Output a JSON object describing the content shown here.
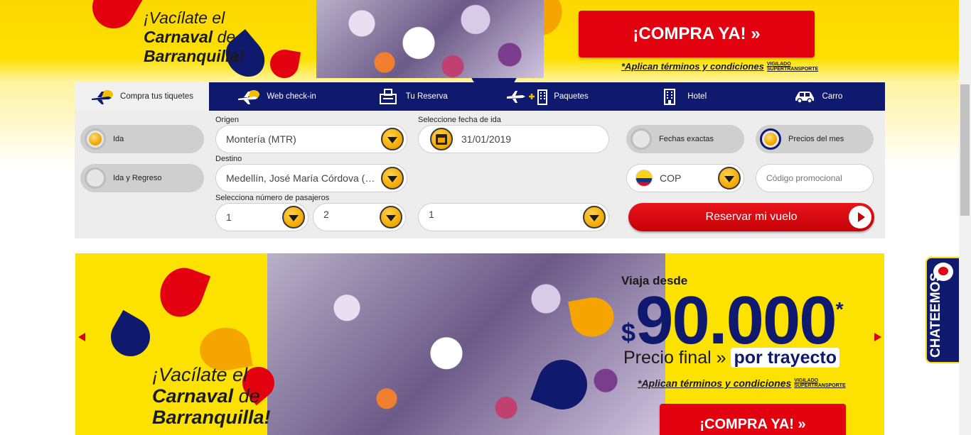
{
  "promo_top": {
    "title_line1": "¡Vacílate el",
    "title_line2_bold": "Carnaval",
    "title_line2_rest": "de",
    "title_line3": "Barranquilla!",
    "buy_label": "¡COMPRA YA!  »",
    "terms": "*Aplican términos y condiciones",
    "vigilado": "VIGILADO SUPERTRANSPORTE"
  },
  "tabs": [
    {
      "label": "Compra tus tiquetes",
      "icon": "plane-cloud-icon",
      "active": true
    },
    {
      "label": "Web check-in",
      "icon": "plane-cloud-icon"
    },
    {
      "label": "Tu Reserva",
      "icon": "ticket-icon"
    },
    {
      "label": "Paquetes",
      "icon": "plane-hotel-icon"
    },
    {
      "label": "Hotel",
      "icon": "building-icon"
    },
    {
      "label": "Carro",
      "icon": "car-icon"
    }
  ],
  "trip_type": {
    "one_way": "Ida",
    "round_trip": "Ida y Regreso",
    "selected": "Ida"
  },
  "origin": {
    "label": "Origen",
    "value": "Montería (MTR)"
  },
  "destination": {
    "label": "Destino",
    "value": "Medellín, José María Córdova (MDE)"
  },
  "passengers": {
    "label": "Selecciona número de pasajeros",
    "adults": "1",
    "children": "2",
    "infants": "1"
  },
  "date": {
    "label": "Seleccione fecha de ida",
    "value": "31/01/2019"
  },
  "date_mode": {
    "exact": "Fechas exactas",
    "month": "Precios del mes",
    "selected": "Precios del mes"
  },
  "currency": {
    "value": "COP"
  },
  "promo_code": {
    "placeholder": "Código promocional"
  },
  "reserve_label": "Reservar mi vuelo",
  "hero": {
    "title_line1": "¡Vacílate el",
    "title_line2_bold": "Carnaval",
    "title_line2_rest": "de",
    "title_line3": "Barranquilla!",
    "price_lead": "Viaja desde",
    "currency_symbol": "$",
    "price": "90.000",
    "asterisk": "*",
    "price_sub_a": "Precio final »",
    "price_sub_b": "por trayecto",
    "terms": "*Aplican términos y condiciones",
    "vigilado": "VIGILADO SUPERTRANSPORTE",
    "buy_label": "¡COMPRA YA!  »"
  },
  "chat_label": "CHATEEMOS",
  "colors": {
    "brand_navy": "#0f1a6e",
    "brand_yellow": "#fde200",
    "brand_red": "#e3000f",
    "accent_orange": "#f3a600"
  }
}
